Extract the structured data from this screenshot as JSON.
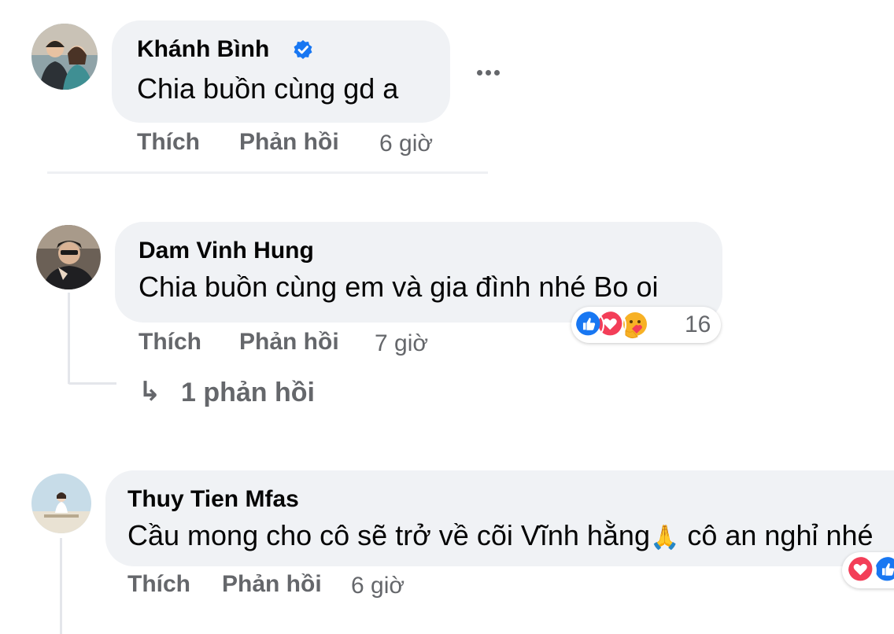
{
  "colors": {
    "bubble": "#f0f2f5",
    "meta_text": "#65676b",
    "verified_blue": "#1877f2",
    "like_blue": "#1877f2",
    "love_red": "#f33e58",
    "care_yellow": "#f7b125"
  },
  "comments": [
    {
      "author": "Khánh Bình",
      "verified": true,
      "text": "Chia buồn cùng gd a",
      "actions": {
        "like": "Thích",
        "reply": "Phản hồi",
        "time": "6 giờ"
      },
      "more_icon": "more-horizontal-icon"
    },
    {
      "author": "Dam Vinh Hung",
      "text": "Chia buồn cùng em và gia đình nhé Bo oi",
      "actions": {
        "like": "Thích",
        "reply": "Phản hồi",
        "time": "7 giờ"
      },
      "reactions": {
        "icons": [
          "like-icon",
          "love-icon",
          "care-icon"
        ],
        "count": "16"
      },
      "replies_link": "1 phản hồi"
    },
    {
      "author": "Thuy Tien Mfas",
      "text_before_emoji": "Cầu mong cho cô sẽ trở về cõi Vĩnh hằng",
      "emoji": "🙏",
      "text_after_emoji": " cô an nghỉ nhé",
      "actions": {
        "like": "Thích",
        "reply": "Phản hồi",
        "time": "6 giờ"
      },
      "reactions": {
        "icons": [
          "love-icon",
          "like-icon"
        ]
      }
    }
  ]
}
